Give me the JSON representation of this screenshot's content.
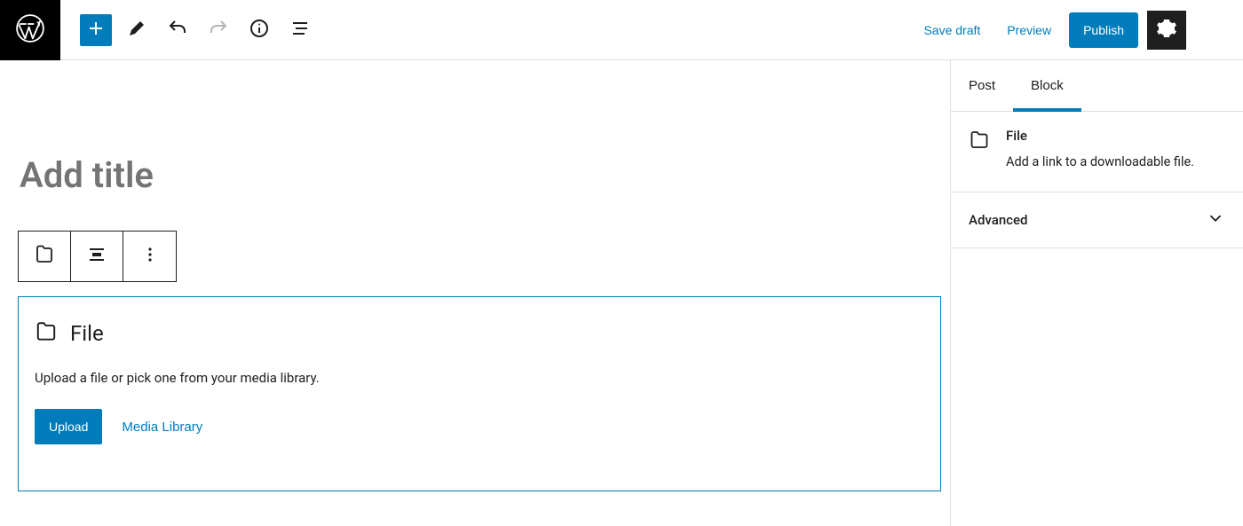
{
  "topbar": {
    "save_draft": "Save draft",
    "preview": "Preview",
    "publish": "Publish"
  },
  "editor": {
    "title_placeholder": "Add title",
    "file_block": {
      "title": "File",
      "instructions": "Upload a file or pick one from your media library.",
      "upload_label": "Upload",
      "media_library_label": "Media Library"
    }
  },
  "sidebar": {
    "tabs": {
      "post": "Post",
      "block": "Block"
    },
    "block_info": {
      "name": "File",
      "description": "Add a link to a downloadable file."
    },
    "advanced_label": "Advanced"
  }
}
